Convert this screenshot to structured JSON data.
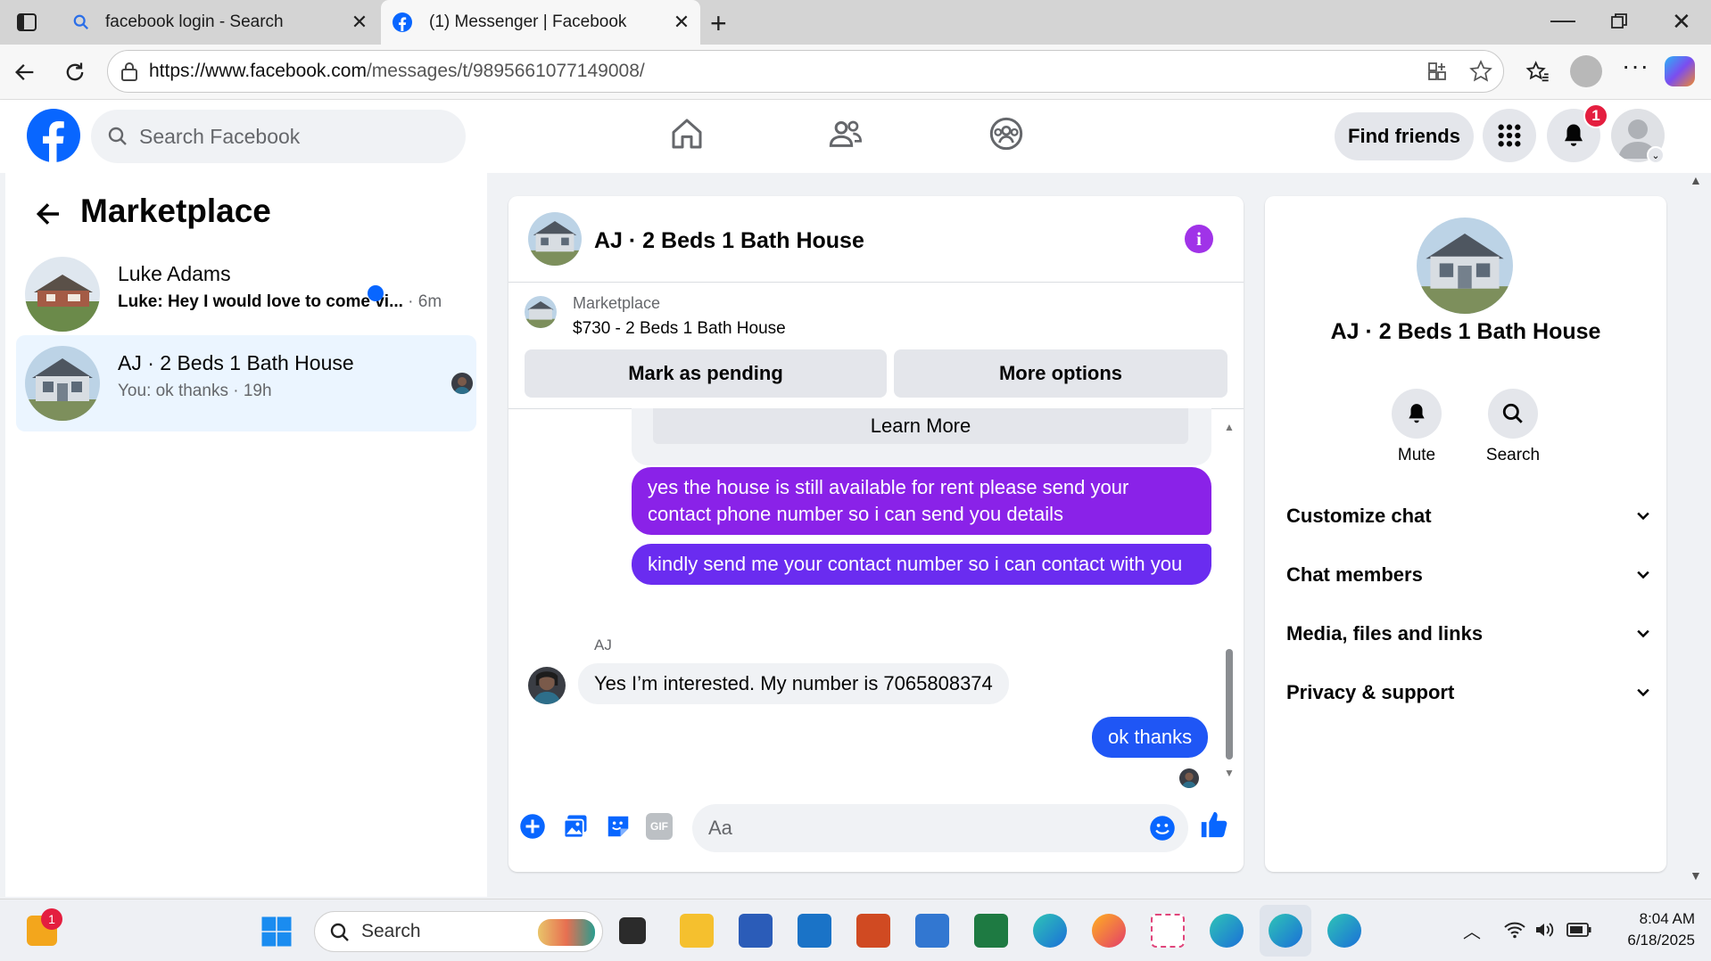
{
  "browser": {
    "tabs": [
      {
        "title": "facebook login - Search"
      },
      {
        "title": "(1) Messenger | Facebook"
      }
    ],
    "url_base": "https://www.facebook.com",
    "url_path": "/messages/t/9895661077149008/"
  },
  "fb_header": {
    "search_placeholder": "Search Facebook",
    "find_friends": "Find friends",
    "notification_count": "1"
  },
  "left": {
    "title": "Marketplace",
    "conversations": [
      {
        "name": "Luke Adams",
        "preview": "Luke: Hey I would love to come vi...",
        "time": "6m",
        "unread": true
      },
      {
        "name": "AJ · 2 Beds 1 Bath House",
        "preview": "You: ok thanks",
        "time": "19h",
        "unread": false
      }
    ]
  },
  "chat": {
    "title": "AJ · 2 Beds 1 Bath House",
    "listing_source": "Marketplace",
    "listing_text": "$730 - 2 Beds 1 Bath House",
    "mark_pending": "Mark as pending",
    "more_options": "More options",
    "learn_more": "Learn More",
    "messages": [
      {
        "from": "me",
        "text": "yes the house is still available for rent please send your contact phone number so i can send you details"
      },
      {
        "from": "me",
        "text": "kindly send me your contact number so i can contact with you"
      },
      {
        "from": "AJ",
        "sender_label": "AJ",
        "text": "Yes I’m interested. My number is 7065808374"
      },
      {
        "from": "me",
        "text": "ok thanks"
      }
    ],
    "composer_placeholder": "Aa"
  },
  "right": {
    "title": "AJ · 2 Beds 1 Bath House",
    "mute": "Mute",
    "search": "Search",
    "sections": [
      "Customize chat",
      "Chat members",
      "Media, files and links",
      "Privacy & support"
    ]
  },
  "taskbar": {
    "search_placeholder": "Search",
    "time": "8:04 AM",
    "date": "6/18/2025",
    "widget_badge": "1"
  },
  "colors": {
    "fb_blue": "#0866ff",
    "bubble_purple": "#8a22e8",
    "bubble_violet": "#6a2cf0",
    "bubble_blue": "#1f56f5",
    "badge_red": "#e41e3f"
  }
}
